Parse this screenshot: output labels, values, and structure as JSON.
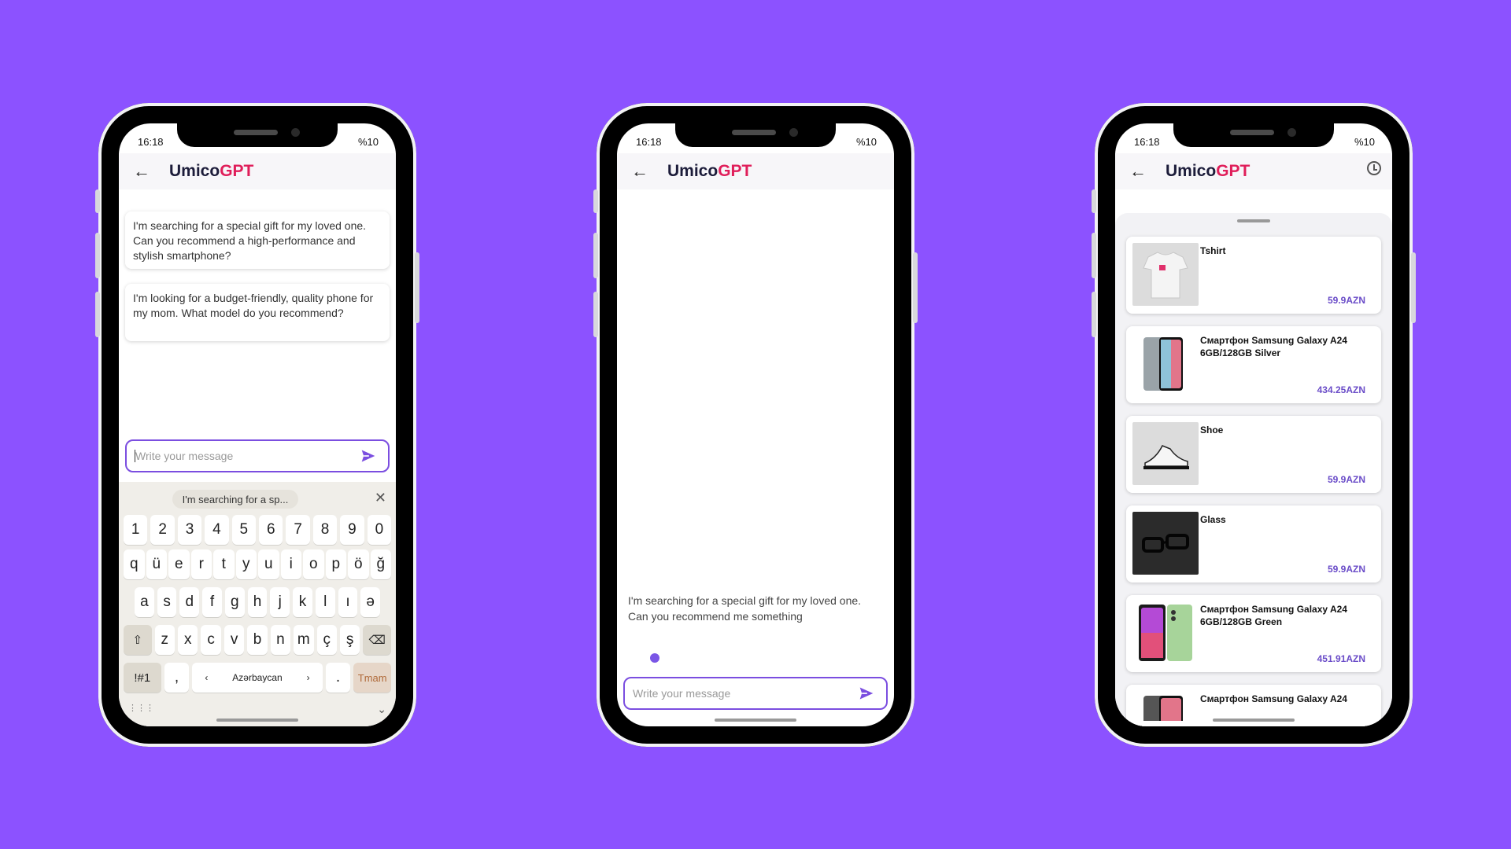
{
  "app": {
    "title_prefix": "Umico",
    "title_suffix": "GPT",
    "status_time": "16:18",
    "status_battery": "%10",
    "accent": "#7b4ee0",
    "brand_pink": "#e01e5a",
    "background": "#8c52ff"
  },
  "phone1": {
    "suggestions": [
      "I'm searching for a special gift for my loved one. Can you recommend a high-performance and stylish smartphone?",
      "I'm looking for a budget-friendly, quality phone for my mom. What model do you recommend?"
    ],
    "input_placeholder": "Write your message",
    "keyboard": {
      "suggestion_chip": "I'm searching for a sp...",
      "row_numbers": [
        "1",
        "2",
        "3",
        "4",
        "5",
        "6",
        "7",
        "8",
        "9",
        "0"
      ],
      "row_q": [
        "q",
        "ü",
        "e",
        "r",
        "t",
        "y",
        "u",
        "i",
        "o",
        "p",
        "ö",
        "ğ"
      ],
      "row_a": [
        "a",
        "s",
        "d",
        "f",
        "g",
        "h",
        "j",
        "k",
        "l",
        "ı",
        "ə"
      ],
      "row_z": [
        "z",
        "x",
        "c",
        "v",
        "b",
        "n",
        "m",
        "ç",
        "ş"
      ],
      "symbols_key": "!#1",
      "comma_key": ",",
      "space_label": "Azərbaycan",
      "period_key": ".",
      "done_key": "Tmam"
    }
  },
  "phone2": {
    "user_message": "I'm searching for a special gift for my loved one. Can you recommend me something",
    "input_placeholder": "Write your message"
  },
  "phone3": {
    "products": [
      {
        "name": "Tshirt",
        "price": "59.9AZN",
        "image": "tshirt"
      },
      {
        "name": "Смартфон Samsung Galaxy A24 6GB/128GB Silver",
        "price": "434.25AZN",
        "image": "phone-silver"
      },
      {
        "name": "Shoe",
        "price": "59.9AZN",
        "image": "shoe"
      },
      {
        "name": "Glass",
        "price": "59.9AZN",
        "image": "glasses"
      },
      {
        "name": "Смартфон Samsung Galaxy A24 6GB/128GB Green",
        "price": "451.91AZN",
        "image": "phone-green"
      },
      {
        "name": "Смартфон Samsung Galaxy A24",
        "price": "",
        "image": "phone-dark"
      }
    ]
  }
}
